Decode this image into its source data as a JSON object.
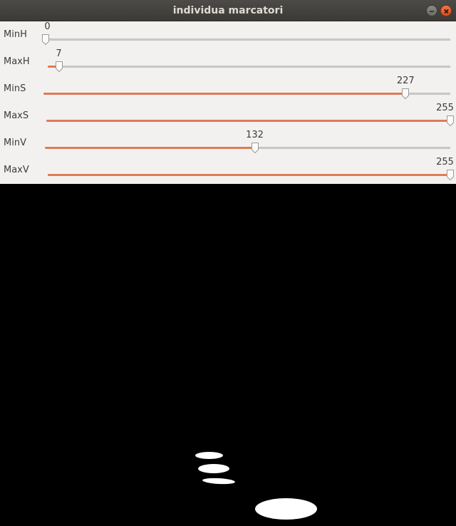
{
  "window": {
    "title": "individua marcatori",
    "buttons": {
      "minimize": "minimize-icon",
      "close": "close-icon"
    }
  },
  "colors": {
    "accent": "#e07a56",
    "panel_bg": "#f2f1f0",
    "canvas_bg": "#000000",
    "mask_fg": "#ffffff"
  },
  "trackbars": [
    {
      "name": "MinH",
      "value": 0,
      "max": 255
    },
    {
      "name": "MaxH",
      "value": 7,
      "max": 255
    },
    {
      "name": "MinS",
      "value": 227,
      "max": 255
    },
    {
      "name": "MaxS",
      "value": 255,
      "max": 255
    },
    {
      "name": "MinV",
      "value": 132,
      "max": 255
    },
    {
      "name": "MaxV",
      "value": 255,
      "max": 255
    }
  ]
}
